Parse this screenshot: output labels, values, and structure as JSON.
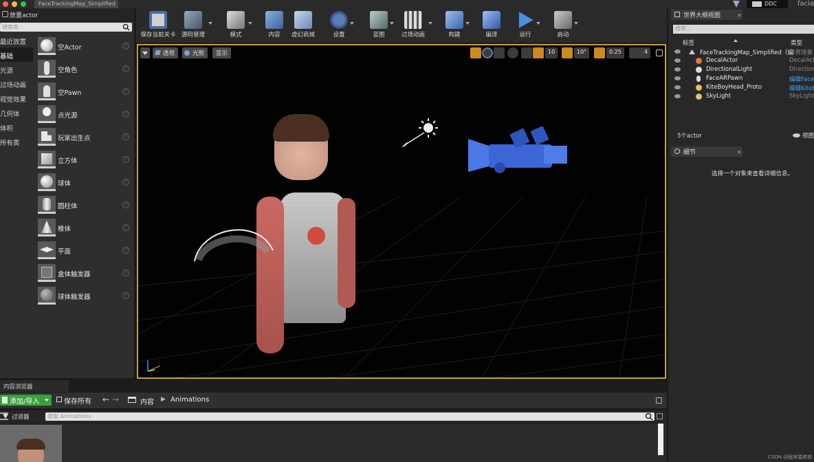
{
  "window": {
    "tab_title": "FaceTrackingMap_Simplified",
    "ddc_label": "DDC",
    "user_label": "facia"
  },
  "place_actors": {
    "title": "放置actor",
    "search_placeholder": "搜索类",
    "categories": [
      "最近放置",
      "基础",
      "光源",
      "过场动画",
      "视觉效果",
      "几何体",
      "体积",
      "所有类"
    ],
    "active_category": "基础",
    "items": [
      {
        "label": "空Actor",
        "icon": "sphere-icon"
      },
      {
        "label": "空角色",
        "icon": "character-icon"
      },
      {
        "label": "空Pawn",
        "icon": "pawn-icon"
      },
      {
        "label": "点光源",
        "icon": "bulb-icon"
      },
      {
        "label": "玩家出生点",
        "icon": "player-start-icon"
      },
      {
        "label": "立方体",
        "icon": "cube-icon"
      },
      {
        "label": "球体",
        "icon": "sphere-icon"
      },
      {
        "label": "圆柱体",
        "icon": "cylinder-icon"
      },
      {
        "label": "椎体",
        "icon": "cone-icon"
      },
      {
        "label": "平面",
        "icon": "plane-icon"
      },
      {
        "label": "盒体触发器",
        "icon": "box-trigger-icon"
      },
      {
        "label": "球体触发器",
        "icon": "sphere-trigger-icon"
      }
    ],
    "help_glyph": "?"
  },
  "toolbar": {
    "buttons": [
      {
        "label": "保存当前关卡",
        "icon": "save-icon"
      },
      {
        "label": "源码管理",
        "icon": "source-control-icon"
      },
      {
        "label": "模式",
        "icon": "modes-icon"
      },
      {
        "label": "内容",
        "icon": "content-icon"
      },
      {
        "label": "虚幻商城",
        "icon": "marketplace-icon"
      },
      {
        "label": "设置",
        "icon": "settings-icon"
      },
      {
        "label": "蓝图",
        "icon": "blueprint-icon"
      },
      {
        "label": "过场动画",
        "icon": "cinematics-icon"
      },
      {
        "label": "构建",
        "icon": "build-icon"
      },
      {
        "label": "编译",
        "icon": "compile-icon"
      },
      {
        "label": "运行",
        "icon": "play-icon"
      },
      {
        "label": "启动",
        "icon": "launch-icon"
      }
    ]
  },
  "viewport": {
    "perspective": "透视",
    "lit": "光照",
    "show": "显示",
    "grid_snap": "10",
    "rotation_snap": "10°",
    "scale_snap": "0.25",
    "camera_speed": "4"
  },
  "content_browser": {
    "tab": "内容浏览器",
    "add_import": "添加/导入",
    "save_all": "保存所有",
    "crumb_root": "内容",
    "crumb_current": "Animations",
    "filters": "过滤器",
    "search_placeholder": "搜索 Animations"
  },
  "outliner": {
    "tab": "世界大纲视图",
    "search_placeholder": "搜索...",
    "col_label": "标签",
    "col_type": "类型",
    "rows": [
      {
        "name": "FaceTrackingMap_Simplified（编",
        "type": "世界场景",
        "link": false
      },
      {
        "name": "DecalActor",
        "type": "DecalActor",
        "link": false
      },
      {
        "name": "DirectionalLight",
        "type": "DirectionalLight",
        "link": false
      },
      {
        "name": "FaceARPawn",
        "type": "编辑FaceARPawn",
        "link": true
      },
      {
        "name": "KiteBoyHead_Proto",
        "type": "编辑KiteBoyHead",
        "link": true
      },
      {
        "name": "SkyLight",
        "type": "SkyLight",
        "link": false
      }
    ],
    "actor_count": "5个actor",
    "view_options": "视图"
  },
  "details": {
    "tab": "细节",
    "empty_message": "选择一个对象来查看详细信息。"
  },
  "watermark": "CSDN @程序猿老铁",
  "colors": {
    "accent": "#c8a03a",
    "link": "#3ba8ff",
    "add_button": "#3aa03a",
    "play": "#4a90e2"
  }
}
